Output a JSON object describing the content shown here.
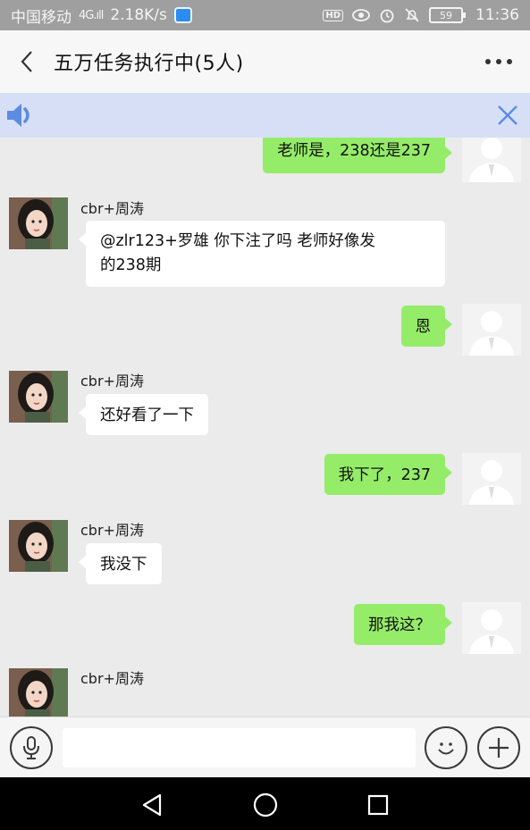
{
  "status_bar": {
    "carrier": "中国移动",
    "signal": "4G.ıll",
    "speed": "2.18K/s",
    "hd_badge": "HD",
    "battery": "59",
    "time": "11:36"
  },
  "header": {
    "title": "五万任务执行中(5人)"
  },
  "colors": {
    "green_bubble": "#95ec69",
    "banner_bg": "#d6dff5",
    "accent_blue": "#5b8ce0"
  },
  "messages": [
    {
      "side": "right",
      "text": "老师是，238还是237"
    },
    {
      "side": "left",
      "sender": "cbr+周涛",
      "line1": "@zlr123+罗雄 你下注了吗  老师好像发",
      "line2": "的238期"
    },
    {
      "side": "right",
      "text": "恩"
    },
    {
      "side": "left",
      "sender": "cbr+周涛",
      "text": "还好看了一下"
    },
    {
      "side": "right",
      "text": "我下了，237"
    },
    {
      "side": "left",
      "sender": "cbr+周涛",
      "text": "我没下"
    },
    {
      "side": "right",
      "text": "那我这？"
    },
    {
      "side": "left",
      "sender": "cbr+周涛"
    }
  ],
  "input": {
    "placeholder": ""
  }
}
